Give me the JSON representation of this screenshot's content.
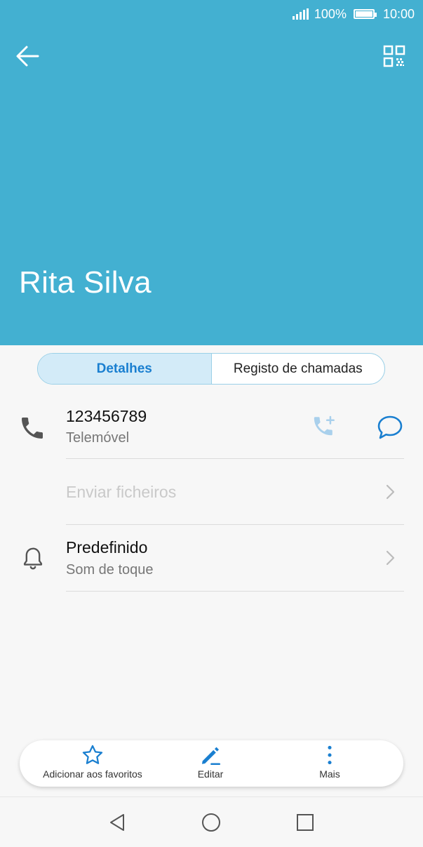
{
  "status_bar": {
    "battery": "100%",
    "time": "10:00"
  },
  "contact": {
    "name": "Rita Silva"
  },
  "tabs": [
    {
      "label": "Detalhes",
      "active": true
    },
    {
      "label": "Registo de chamadas",
      "active": false
    }
  ],
  "phone": {
    "number": "123456789",
    "type": "Telemóvel"
  },
  "send_files": {
    "label": "Enviar ficheiros"
  },
  "ringtone": {
    "value": "Predefinido",
    "label": "Som de toque"
  },
  "actions": {
    "favorite": "Adicionar aos favoritos",
    "edit": "Editar",
    "more": "Mais"
  },
  "colors": {
    "header": "#43b0d1",
    "accent": "#1a7fd0",
    "tab_active_bg": "#d3ebf8"
  }
}
